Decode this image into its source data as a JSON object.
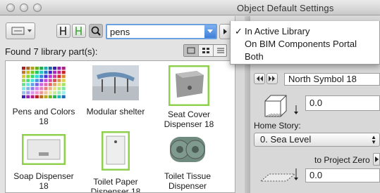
{
  "window": {
    "title": "Object Default Settings"
  },
  "search": {
    "value": "pens"
  },
  "results": {
    "found_text": "Found 7 library part(s):"
  },
  "items": [
    {
      "label": "Pens and Colors 18",
      "icon": "pens-and-colors-thumbnail"
    },
    {
      "label": "Modular shelter",
      "icon": "modular-shelter-thumbnail"
    },
    {
      "label": "Seat Cover Dispenser 18",
      "icon": "seat-cover-dispenser-thumbnail"
    },
    {
      "label": "Soap Dispenser 18",
      "icon": "soap-dispenser-thumbnail"
    },
    {
      "label": "Toilet Paper Dispenser 18",
      "icon": "toilet-paper-dispenser-thumbnail"
    },
    {
      "label": "Toilet Tissue Dispenser",
      "icon": "toilet-tissue-dispenser-thumbnail"
    }
  ],
  "menu": {
    "items": [
      {
        "label": "In Active Library",
        "checked": true
      },
      {
        "label": "On BIM Components Portal",
        "checked": false
      },
      {
        "label": "Both",
        "checked": false
      }
    ],
    "check_mark": "✓"
  },
  "settings": {
    "symbol": "North Symbol 18",
    "elevation": "0.0",
    "home_story_label": "Home Story:",
    "home_story": "0. Sea Level",
    "reference": "to Project Zero",
    "offset": "0.0"
  },
  "colors": {
    "accent": "#6a9fe0",
    "selection_green": "#8fd14f"
  }
}
